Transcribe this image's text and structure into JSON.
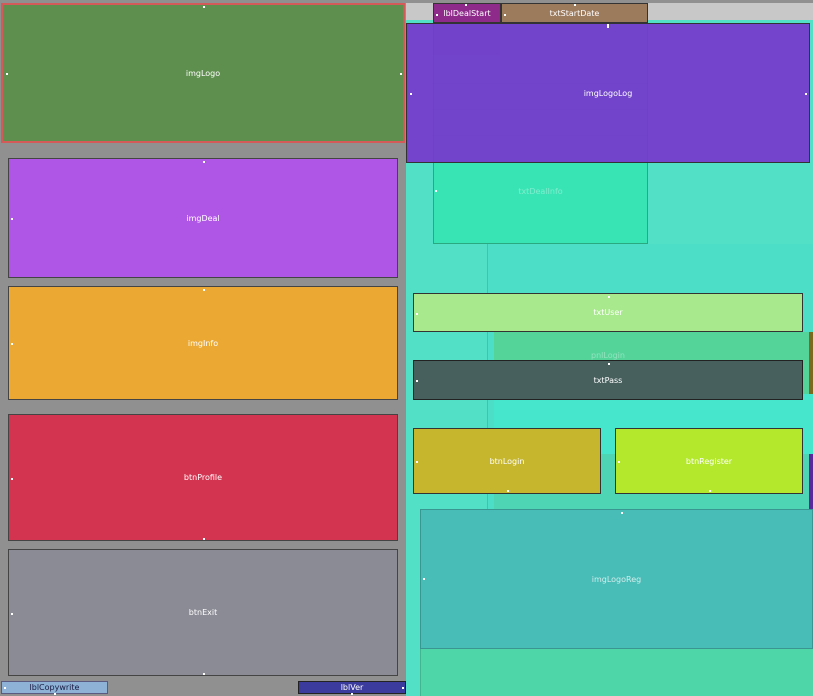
{
  "left_panel": {
    "imgLogo": "imgLogo",
    "imgDeal": "imgDeal",
    "imgInfo": "imgInfo",
    "btnProfile": "btnProfile",
    "btnExit": "btnExit",
    "lblCopywrite": "lblCopywrite",
    "lblVer": "lblVer"
  },
  "deal_panel": {
    "lblDealStart": "lblDealStart",
    "txtStartDate": "txtStartDate",
    "txtDealInfo": "txtDealInfo"
  },
  "login_panel": {
    "imgLogoLog": "imgLogoLog",
    "txtUser": "txtUser",
    "pnlLogin": "pnlLogin",
    "txtPass": "txtPass",
    "btnLogin": "btnLogin",
    "btnRegister": "btnRegister"
  },
  "register_panel": {
    "imgLogoReg": "imgLogoReg"
  },
  "colors": {
    "imgLogo": "#5f8f4e",
    "imgDeal": "#b056e6",
    "imgInfo": "#eba934",
    "btnProfile": "#d33450",
    "btnExit": "#8b8b95",
    "imgLogoLog": "#7638ce",
    "txtUser": "#a8e98d",
    "txtPass": "#47605e",
    "btnLogin": "#c6b62e",
    "btnRegister": "#b4e82c",
    "imgLogoReg": "#48bcb6",
    "right_panel": "#52e0c6",
    "selected_border": "#d45a5a"
  }
}
